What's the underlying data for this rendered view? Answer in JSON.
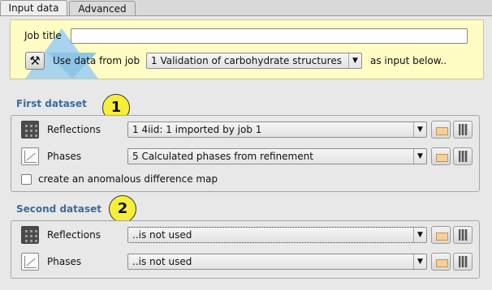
{
  "tabs": [
    {
      "label": "Input data"
    },
    {
      "label": "Advanced"
    }
  ],
  "header": {
    "job_title_label": "Job title",
    "job_title_value": "",
    "use_data_label": "Use data from job",
    "job_select_value": "1 Validation of carbohydrate structures",
    "as_input_label": "as input below.."
  },
  "first_dataset": {
    "title": "First dataset",
    "badge": "1",
    "reflections_label": "Reflections",
    "reflections_value": "1 4iid: 1 imported by job 1",
    "phases_label": "Phases",
    "phases_value": "5 Calculated phases from refinement",
    "anomalous_label": "create an anomalous difference map",
    "anomalous_checked": false
  },
  "second_dataset": {
    "title": "Second dataset",
    "badge": "2",
    "reflections_label": "Reflections",
    "reflections_value": "..is not used",
    "phases_label": "Phases",
    "phases_value": "..is not used"
  },
  "icons": {
    "run_button": "hammer-icon",
    "reflections": "reflections-icon",
    "phases": "phases-icon",
    "browse": "folder-icon",
    "view": "view-icon"
  },
  "colors": {
    "header_background": "#fffcc4",
    "section_title": "#3a6c9e",
    "badge": "#f6ef3a",
    "logo": "#a8d4ee"
  }
}
